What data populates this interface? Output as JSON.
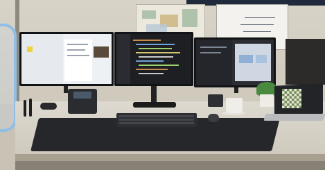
{
  "scene": {
    "description_label": "",
    "monitors": 3,
    "has_laptop": true
  },
  "colors": {
    "wall": "#d8d3c8",
    "desk": "#ddd9cf",
    "mat": "#26272a",
    "accent_bracket": "#8fbfe6",
    "monitor_bezel": "#121316"
  }
}
